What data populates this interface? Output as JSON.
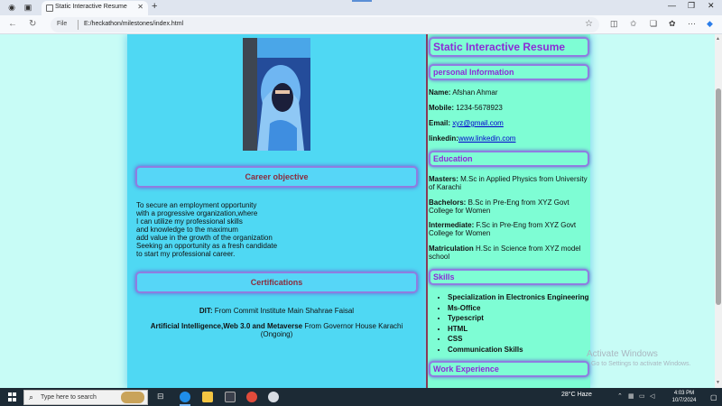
{
  "browser": {
    "tab_title": "Static Interactive Resume",
    "address_scheme": "File",
    "address_url": "E:/heckathon/milestones/index.html"
  },
  "left": {
    "career_heading": "Career objective",
    "objective_lines": [
      "To secure an employment opportunity",
      "with a progressive organization,where",
      "I can utilize my professional skills",
      "and knowledge to the maximum",
      "add value in the growth of the organization",
      "Seeking an opportunity as a fresh candidate",
      "to start my professional career."
    ],
    "cert_heading": "Certifications",
    "cert1_bold": "DIT:",
    "cert1_text": " From Commit Institute Main Shahrae Faisal",
    "cert2_bold": "Artificial Intelligence,Web 3.0 and Metaverse",
    "cert2_text": " From Governor House Karachi (Ongoing)"
  },
  "right": {
    "title": "Static Interactive Resume",
    "personal_heading": "personal Information",
    "name_label": "Name:",
    "name_value": " Afshan Ahmar",
    "mobile_label": "Mobile:",
    "mobile_value": " 1234-5678923",
    "email_label": "Email:",
    "email_value": "xyz@gmail.com",
    "linkedin_label": "linkedin:",
    "linkedin_value": "www.linkedin.com",
    "education_heading": "Education",
    "edu": [
      {
        "label": "Masters:",
        "text": " M.Sc in Applied Physics from University of Karachi"
      },
      {
        "label": "Bachelors:",
        "text": " B.Sc in Pre-Eng from XYZ Govt College for Women"
      },
      {
        "label": "Intermediate:",
        "text": " F.Sc in Pre-Eng from XYZ Govt College for Women"
      },
      {
        "label": "Matriculation",
        "text": " H.Sc in Science from XYZ model school"
      }
    ],
    "skills_heading": "Skills",
    "skills": [
      "Specialization in Electronics Engineering",
      "Ms-Office",
      "Typescript",
      "HTML",
      "CSS",
      "Communication Skills"
    ],
    "work_heading": "Work Experience"
  },
  "watermark": {
    "line1": "Activate Windows",
    "line2": "Go to Settings to activate Windows."
  },
  "taskbar": {
    "search_placeholder": "Type here to search",
    "weather": "28°C  Haze",
    "time": "4:03 PM",
    "date": "10/7/2024"
  }
}
